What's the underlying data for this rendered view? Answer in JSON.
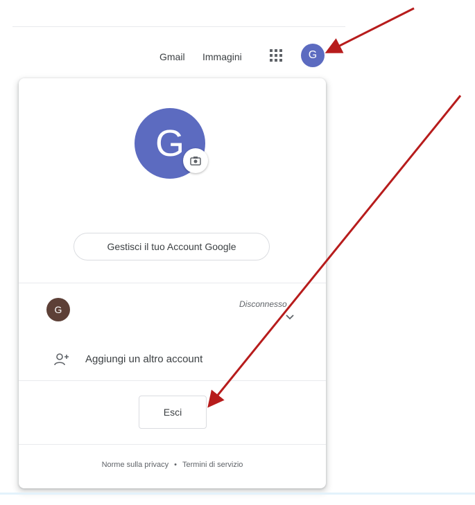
{
  "header": {
    "gmail_label": "Gmail",
    "images_label": "Immagini",
    "apps_icon": "grid-apps-icon",
    "avatar_letter": "G"
  },
  "account_panel": {
    "avatar_letter": "G",
    "camera_icon": "camera-icon",
    "manage_account_label": "Gestisci il tuo Account Google",
    "accounts": [
      {
        "avatar_letter": "G",
        "status": "Disconnesso"
      }
    ],
    "add_account_label": "Aggiungi un altro account",
    "sign_out_label": "Esci",
    "footer": {
      "privacy_label": "Norme sulla privacy",
      "separator": "•",
      "terms_label": "Termini di servizio"
    }
  },
  "annotations": {
    "arrow_color": "#b71c1c"
  },
  "colors": {
    "avatar_blue": "#5c6bc0",
    "avatar_brown": "#5d4037",
    "border": "#dadce0",
    "text": "#3c4043"
  }
}
